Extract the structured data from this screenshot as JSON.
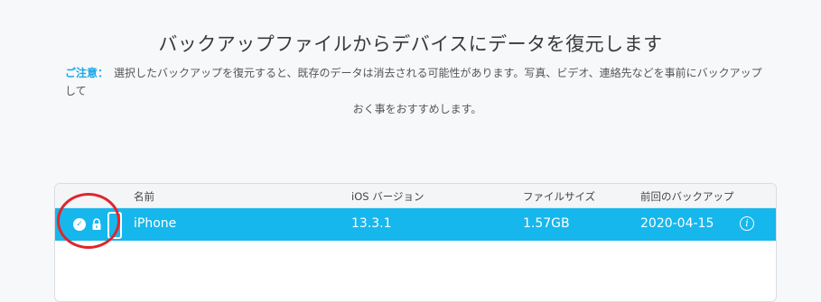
{
  "header": {
    "title": "バックアップファイルからデバイスにデータを復元します"
  },
  "notice": {
    "label": "ご注意：",
    "line1": "選択したバックアップを復元すると、既存のデータは消去される可能性があります。写真、ビデオ、連絡先などを事前にバックアップして",
    "line2": "おく事をおすすめします。"
  },
  "table": {
    "headers": {
      "name": "名前",
      "ios_version": "iOS バージョン",
      "file_size": "ファイルサイズ",
      "last_backup": "前回のバックアップ"
    },
    "rows": [
      {
        "name": "iPhone",
        "ios_version": "13.3.1",
        "file_size": "1.57GB",
        "last_backup": "2020-04-15"
      }
    ]
  },
  "icons": {
    "checkbox": "check-icon",
    "lock": "lock-icon",
    "device": "iphone-icon",
    "info": "info-icon"
  },
  "colors": {
    "accent": "#16b7ec",
    "notice_label": "#1aa8e6",
    "highlight_circle": "#e0262b"
  }
}
